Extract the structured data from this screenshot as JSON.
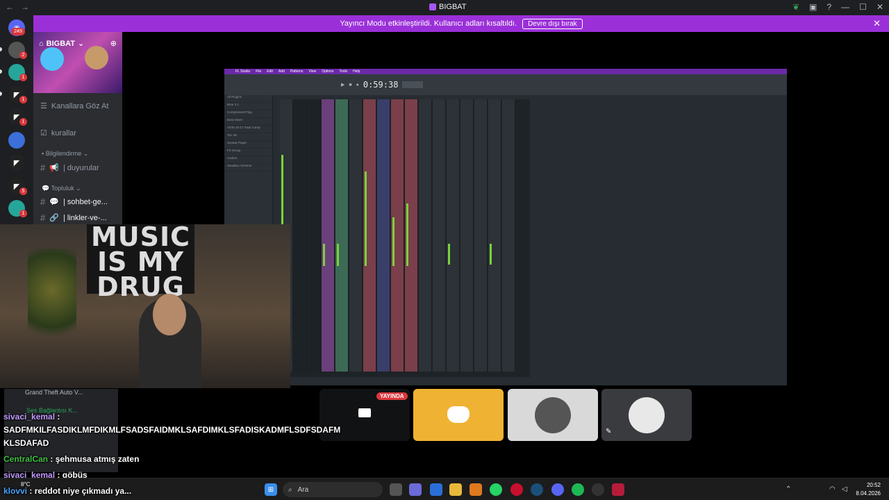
{
  "window": {
    "title": "BIGBAT"
  },
  "banner": {
    "text": "Yayıncı Modu etkinleştirildi. Kullanıcı adları kısaltıldı.",
    "button": "Devre dışı bırak"
  },
  "rail": {
    "home_badge": "249",
    "badges": [
      "2",
      "1",
      "1",
      "1",
      "1",
      "5",
      "1"
    ]
  },
  "sidebar": {
    "server_name": "BIGBAT",
    "browse": "Kanallara Göz At",
    "rules": "kurallar",
    "cat_info": "Bilgilendirme",
    "announcements": "| duyurular",
    "cat_community": "Topluluk",
    "general_chat": "| sohbet-ge...",
    "links": "| linkler-ve-..."
  },
  "fl": {
    "menu": [
      "FL Studio",
      "File",
      "Edit",
      "Add",
      "Patterns",
      "View",
      "Options",
      "Tools",
      "Help"
    ],
    "time": "0:59:38",
    "browser_items": [
      "All Plugins",
      "Bear 3.1",
      "Compressed Plug",
      "Boss Mixer",
      "VSTa 16-17 Total Comp",
      "Tex 3N",
      "Sonata Plugin",
      "FX Group",
      "AudioX",
      "Sandbox Scheme"
    ]
  },
  "voice_panel": {
    "game": "Grand Theft Auto V...",
    "status": "Ses Bağlantısı K..."
  },
  "stage": {
    "live_label": "YAYINDA"
  },
  "chat": [
    {
      "user": "sivaci_kemal",
      "sep": " :",
      "msg": ""
    },
    {
      "user": "",
      "sep": "",
      "msg": "SADFMKILFASDIKLMFDIKMLFSADSFAIDMKLSAFDIMKLSFADISKADMFLSDFSDAFM"
    },
    {
      "user": "",
      "sep": "",
      "msg": "KLSDAFAD"
    },
    {
      "user": "CentralCan",
      "sep": " : ",
      "msg": "şehmusa atmış zaten"
    },
    {
      "user": "sivaci_kemal",
      "sep": " : ",
      "msg": "göbüş"
    },
    {
      "user": "klovvi",
      "sep": " : ",
      "msg": "reddot niye çıkmadı ya..."
    }
  ],
  "taskbar": {
    "weather_temp": "8°C",
    "search_placeholder": "Ara",
    "time": "20:52",
    "date": "8.04.2026"
  },
  "colors": {
    "banner": "#9b30d9",
    "discord_tile": "#f0b232",
    "live": "#da373c"
  }
}
